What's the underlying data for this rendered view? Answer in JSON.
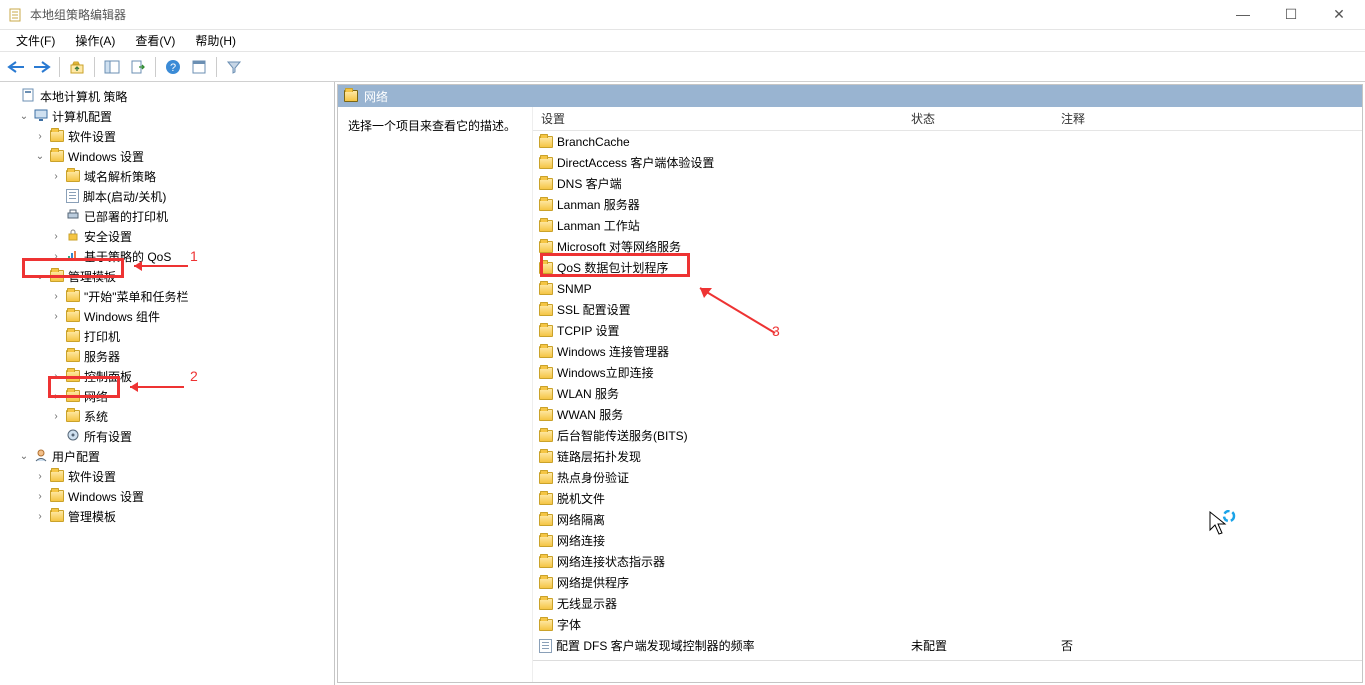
{
  "window": {
    "title": "本地组策略编辑器"
  },
  "menu": {
    "file": "文件(F)",
    "action": "操作(A)",
    "view": "查看(V)",
    "help": "帮助(H)"
  },
  "tree": {
    "root": "本地计算机 策略",
    "computer_cfg": "计算机配置",
    "software_settings": "软件设置",
    "windows_settings": "Windows 设置",
    "dns_policy": "域名解析策略",
    "scripts": "脚本(启动/关机)",
    "deployed_printers": "已部署的打印机",
    "security_settings": "安全设置",
    "qos_policy": "基于策略的 QoS",
    "admin_templates": "管理模板",
    "start_menu_taskbar": "\"开始\"菜单和任务栏",
    "windows_components": "Windows 组件",
    "printers": "打印机",
    "servers": "服务器",
    "control_panel": "控制面板",
    "network": "网络",
    "system": "系统",
    "all_settings": "所有设置",
    "user_cfg": "用户配置",
    "u_software_settings": "软件设置",
    "u_windows_settings": "Windows 设置",
    "u_admin_templates": "管理模板"
  },
  "right": {
    "header": "网络",
    "desc_prompt": "选择一个项目来查看它的描述。",
    "col_setting": "设置",
    "col_state": "状态",
    "col_comment": "注释"
  },
  "items": [
    {
      "label": "BranchCache",
      "type": "folder"
    },
    {
      "label": "DirectAccess 客户端体验设置",
      "type": "folder"
    },
    {
      "label": "DNS 客户端",
      "type": "folder"
    },
    {
      "label": "Lanman 服务器",
      "type": "folder"
    },
    {
      "label": "Lanman 工作站",
      "type": "folder"
    },
    {
      "label": "Microsoft 对等网络服务",
      "type": "folder"
    },
    {
      "label": "QoS 数据包计划程序",
      "type": "folder"
    },
    {
      "label": "SNMP",
      "type": "folder"
    },
    {
      "label": "SSL 配置设置",
      "type": "folder"
    },
    {
      "label": "TCPIP 设置",
      "type": "folder"
    },
    {
      "label": "Windows 连接管理器",
      "type": "folder"
    },
    {
      "label": "Windows立即连接",
      "type": "folder"
    },
    {
      "label": "WLAN 服务",
      "type": "folder"
    },
    {
      "label": "WWAN 服务",
      "type": "folder"
    },
    {
      "label": "后台智能传送服务(BITS)",
      "type": "folder"
    },
    {
      "label": "链路层拓扑发现",
      "type": "folder"
    },
    {
      "label": "热点身份验证",
      "type": "folder"
    },
    {
      "label": "脱机文件",
      "type": "folder"
    },
    {
      "label": "网络隔离",
      "type": "folder"
    },
    {
      "label": "网络连接",
      "type": "folder"
    },
    {
      "label": "网络连接状态指示器",
      "type": "folder"
    },
    {
      "label": "网络提供程序",
      "type": "folder"
    },
    {
      "label": "无线显示器",
      "type": "folder"
    },
    {
      "label": "字体",
      "type": "folder"
    },
    {
      "label": "配置 DFS 客户端发现域控制器的频率",
      "type": "setting",
      "state": "未配置",
      "comment": "否"
    }
  ],
  "annotations": {
    "label1": "1",
    "label2": "2",
    "label3": "3"
  }
}
